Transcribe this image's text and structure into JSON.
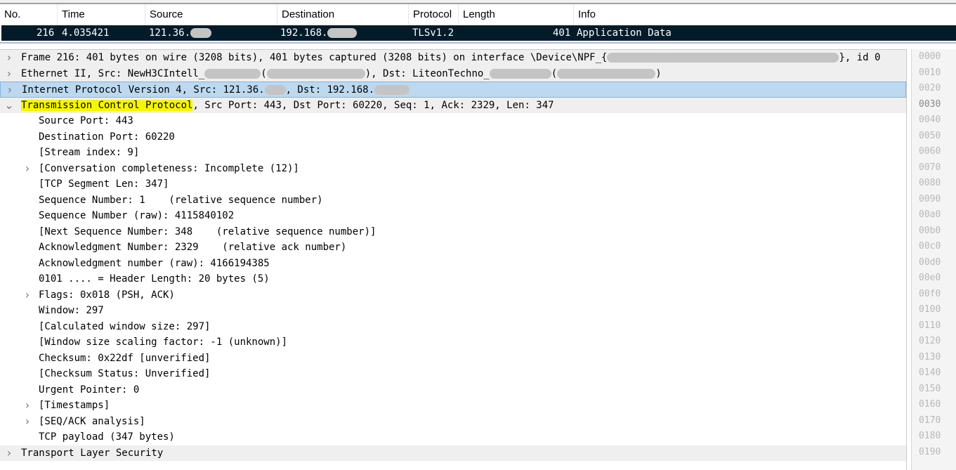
{
  "packet_list": {
    "columns": [
      "No.",
      "Time",
      "Source",
      "Destination",
      "Protocol",
      "Length",
      "Info"
    ],
    "selected_row": {
      "no": "216",
      "time": "4.035421",
      "source": "121.36.",
      "destination": "192.168.",
      "protocol": "TLSv1.2",
      "length": "401",
      "info": "Application Data"
    }
  },
  "tree": [
    {
      "text": "Frame 216: 401 bytes on wire (3208 bits), 401 bytes captured (3208 bits) on interface \\Device\\NPF_{",
      "tail": "}, id 0",
      "level": 0,
      "expander": "collapsed"
    },
    {
      "text": "Ethernet II, Src: NewH3CIntell_",
      "mid": "(",
      "mid2": "), Dst: LiteonTechno_",
      "mid3": "(",
      "tail": ")",
      "level": 0,
      "expander": "collapsed"
    },
    {
      "text": "Internet Protocol Version 4, Src: 121.36.",
      "mid": ", Dst: 192.168.",
      "level": 0,
      "expander": "collapsed",
      "selected": true
    },
    {
      "text": "Transmission Control Protocol",
      "tail": ", Src Port: 443, Dst Port: 60220, Seq: 1, Ack: 2329, Len: 347",
      "level": 0,
      "expander": "expanded",
      "highlight": "#f6f600"
    },
    {
      "text": "Source Port: 443",
      "level": 1
    },
    {
      "text": "Destination Port: 60220",
      "level": 1
    },
    {
      "text": "[Stream index: 9]",
      "level": 1
    },
    {
      "text": "[Conversation completeness: Incomplete (12)]",
      "level": 1,
      "expander": "collapsed"
    },
    {
      "text": "[TCP Segment Len: 347]",
      "level": 1
    },
    {
      "text": "Sequence Number: 1    (relative sequence number)",
      "level": 1
    },
    {
      "text": "Sequence Number (raw): 4115840102",
      "level": 1
    },
    {
      "text": "[Next Sequence Number: 348    (relative sequence number)]",
      "level": 1
    },
    {
      "text": "Acknowledgment Number: 2329    (relative ack number)",
      "level": 1
    },
    {
      "text": "Acknowledgment number (raw): 4166194385",
      "level": 1
    },
    {
      "text": "0101 .... = Header Length: 20 bytes (5)",
      "level": 1
    },
    {
      "text": "Flags: 0x018 (PSH, ACK)",
      "level": 1,
      "expander": "collapsed"
    },
    {
      "text": "Window: 297",
      "level": 1
    },
    {
      "text": "[Calculated window size: 297]",
      "level": 1
    },
    {
      "text": "[Window size scaling factor: -1 (unknown)]",
      "level": 1
    },
    {
      "text": "Checksum: 0x22df [unverified]",
      "level": 1
    },
    {
      "text": "[Checksum Status: Unverified]",
      "level": 1
    },
    {
      "text": "Urgent Pointer: 0",
      "level": 1
    },
    {
      "text": "[Timestamps]",
      "level": 1,
      "expander": "collapsed"
    },
    {
      "text": "[SEQ/ACK analysis]",
      "level": 1,
      "expander": "collapsed"
    },
    {
      "text": "TCP payload (347 bytes)",
      "level": 1
    },
    {
      "text": "Transport Layer Security",
      "level": 0,
      "expander": "collapsed"
    }
  ],
  "hex_offsets": [
    "0000",
    "0010",
    "0020",
    "0030",
    "0040",
    "0050",
    "0060",
    "0070",
    "0080",
    "0090",
    "00a0",
    "00b0",
    "00c0",
    "00d0",
    "00e0",
    "00f0",
    "0100",
    "0110",
    "0120",
    "0130",
    "0140",
    "0150",
    "0160",
    "0170",
    "0180",
    "0190"
  ]
}
